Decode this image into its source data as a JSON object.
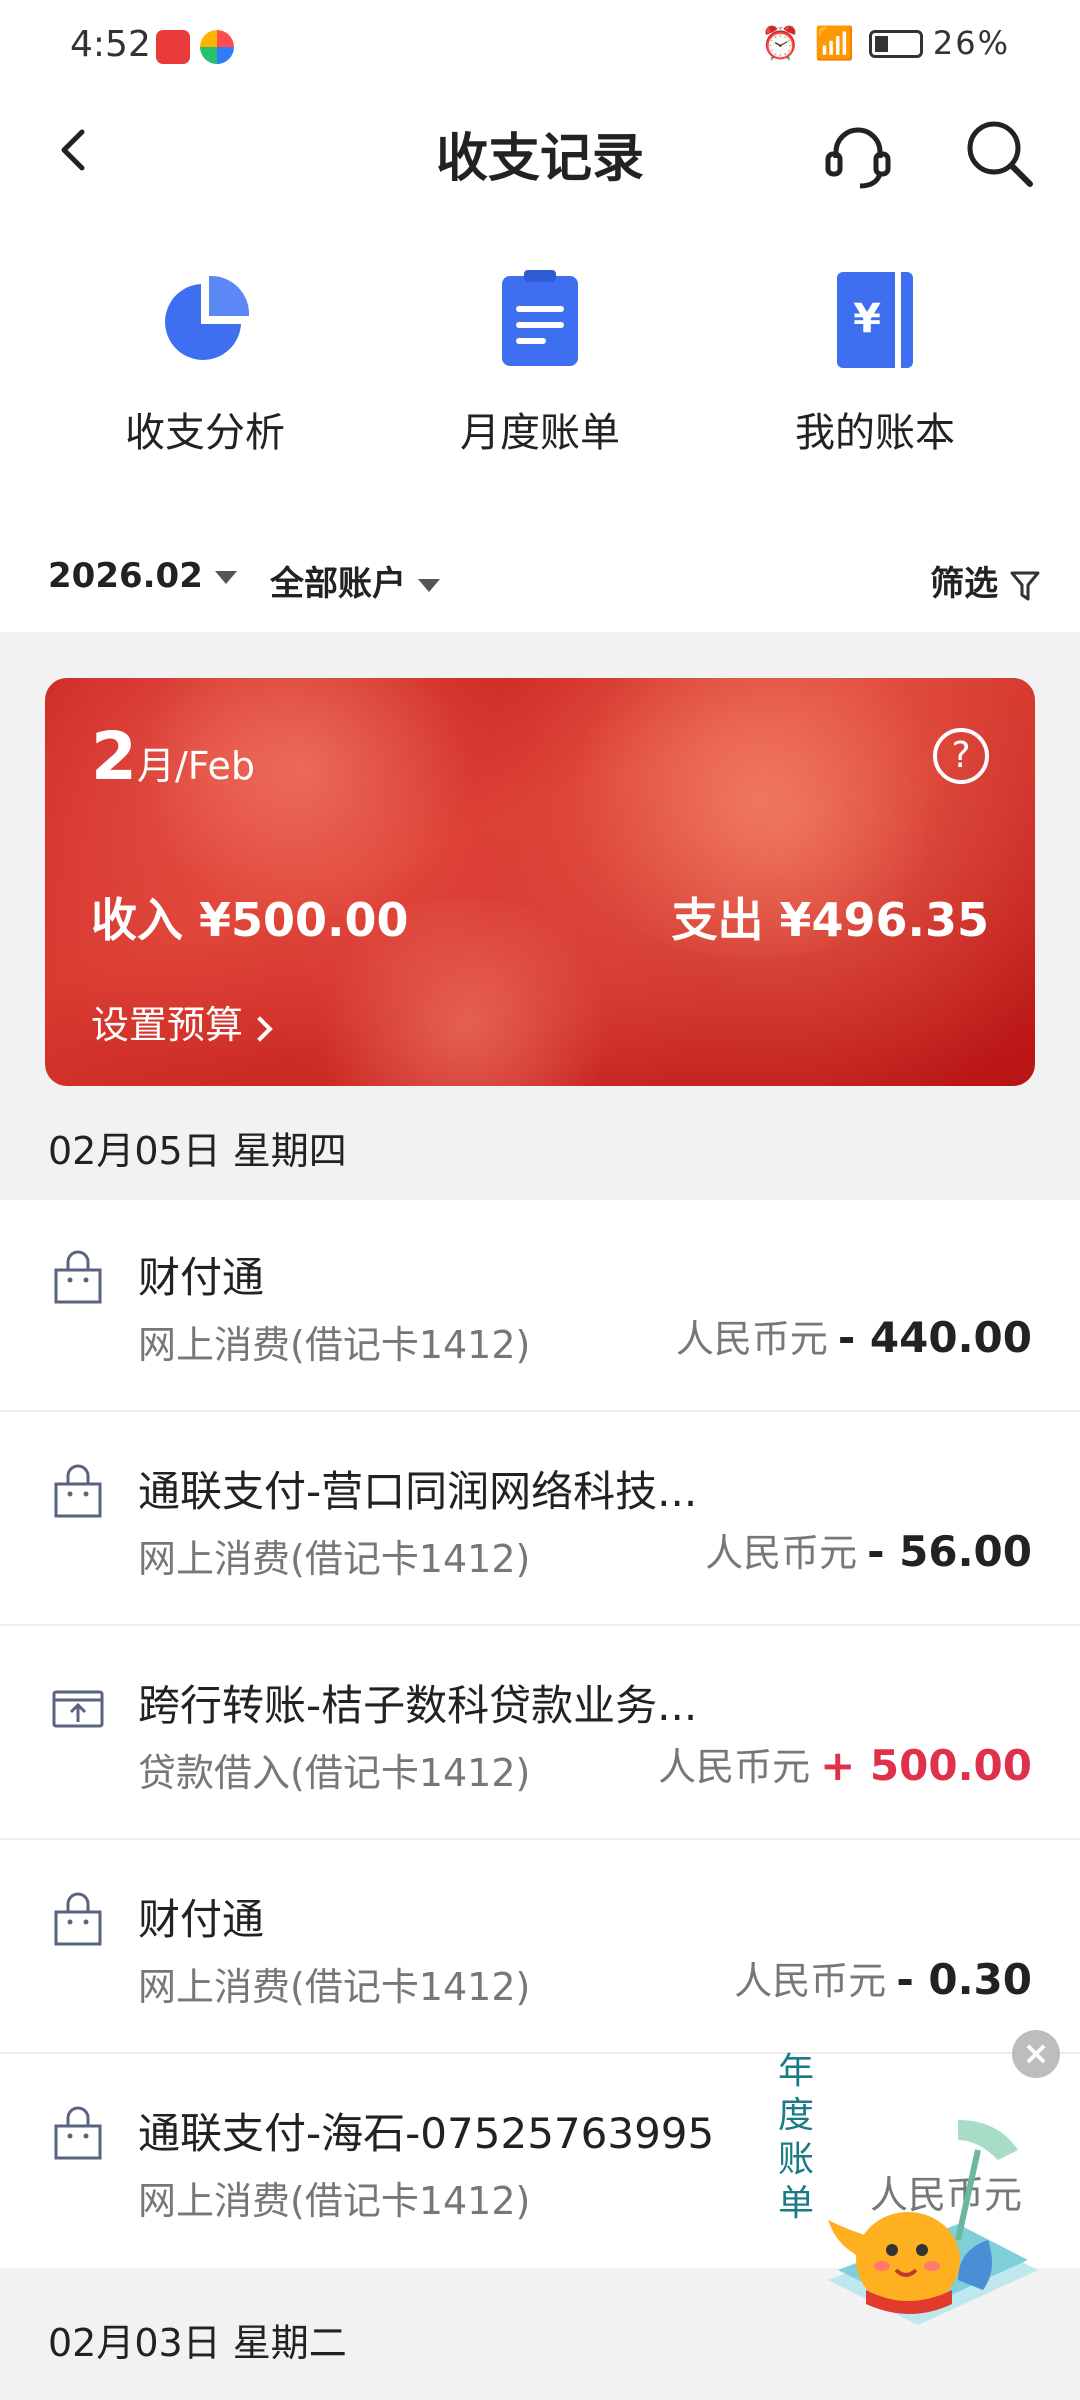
{
  "status_bar": {
    "time": "4:52",
    "battery": "26%",
    "network": "4G"
  },
  "header": {
    "title": "收支记录",
    "back_icon": "chevron-left-icon",
    "service_icon": "headset-icon",
    "search_icon": "search-icon"
  },
  "quick_entries": [
    {
      "label": "收支分析",
      "icon": "pie-chart-icon"
    },
    {
      "label": "月度账单",
      "icon": "clipboard-icon"
    },
    {
      "label": "我的账本",
      "icon": "ledger-icon"
    }
  ],
  "filter": {
    "date": "2026.02",
    "account": "全部账户",
    "screen_label": "筛选"
  },
  "month_card": {
    "month_number": "2",
    "month_suffix": "月/Feb",
    "help_symbol": "?",
    "income": "收入 ¥500.00",
    "expense": "支出 ¥496.35",
    "budget_link": "设置预算"
  },
  "days": [
    {
      "date": "02月05日 星期四",
      "transactions": [
        {
          "name": "财付通",
          "desc": "网上消费(借记卡1412)",
          "currency": "人民币元",
          "amount": "- 440.00",
          "icon": "shopping-bag-icon",
          "positive": false
        },
        {
          "name": "通联支付-营口同润网络科技...",
          "desc": "网上消费(借记卡1412)",
          "currency": "人民币元",
          "amount": "- 56.00",
          "icon": "shopping-bag-icon",
          "positive": false
        },
        {
          "name": "跨行转账-桔子数科贷款业务...",
          "desc": "贷款借入(借记卡1412)",
          "currency": "人民币元",
          "amount": "+ 500.00",
          "icon": "transfer-in-icon",
          "positive": true
        },
        {
          "name": "财付通",
          "desc": "网上消费(借记卡1412)",
          "currency": "人民币元",
          "amount": "- 0.30",
          "icon": "shopping-bag-icon",
          "positive": false
        },
        {
          "name": "通联支付-海石-07525763995",
          "desc": "网上消费(借记卡1412)",
          "currency": "人民币元",
          "amount": "",
          "icon": "shopping-bag-icon",
          "positive": false
        }
      ]
    },
    {
      "date": "02月03日 星期二",
      "transactions": []
    }
  ],
  "promo": {
    "text": "年度账单",
    "close_symbol": "×"
  },
  "colors": {
    "accent_blue": "#3e6ff0",
    "card_red": "#c8201f",
    "income_red": "#e0314b",
    "page_grey": "#f2f2f2"
  }
}
